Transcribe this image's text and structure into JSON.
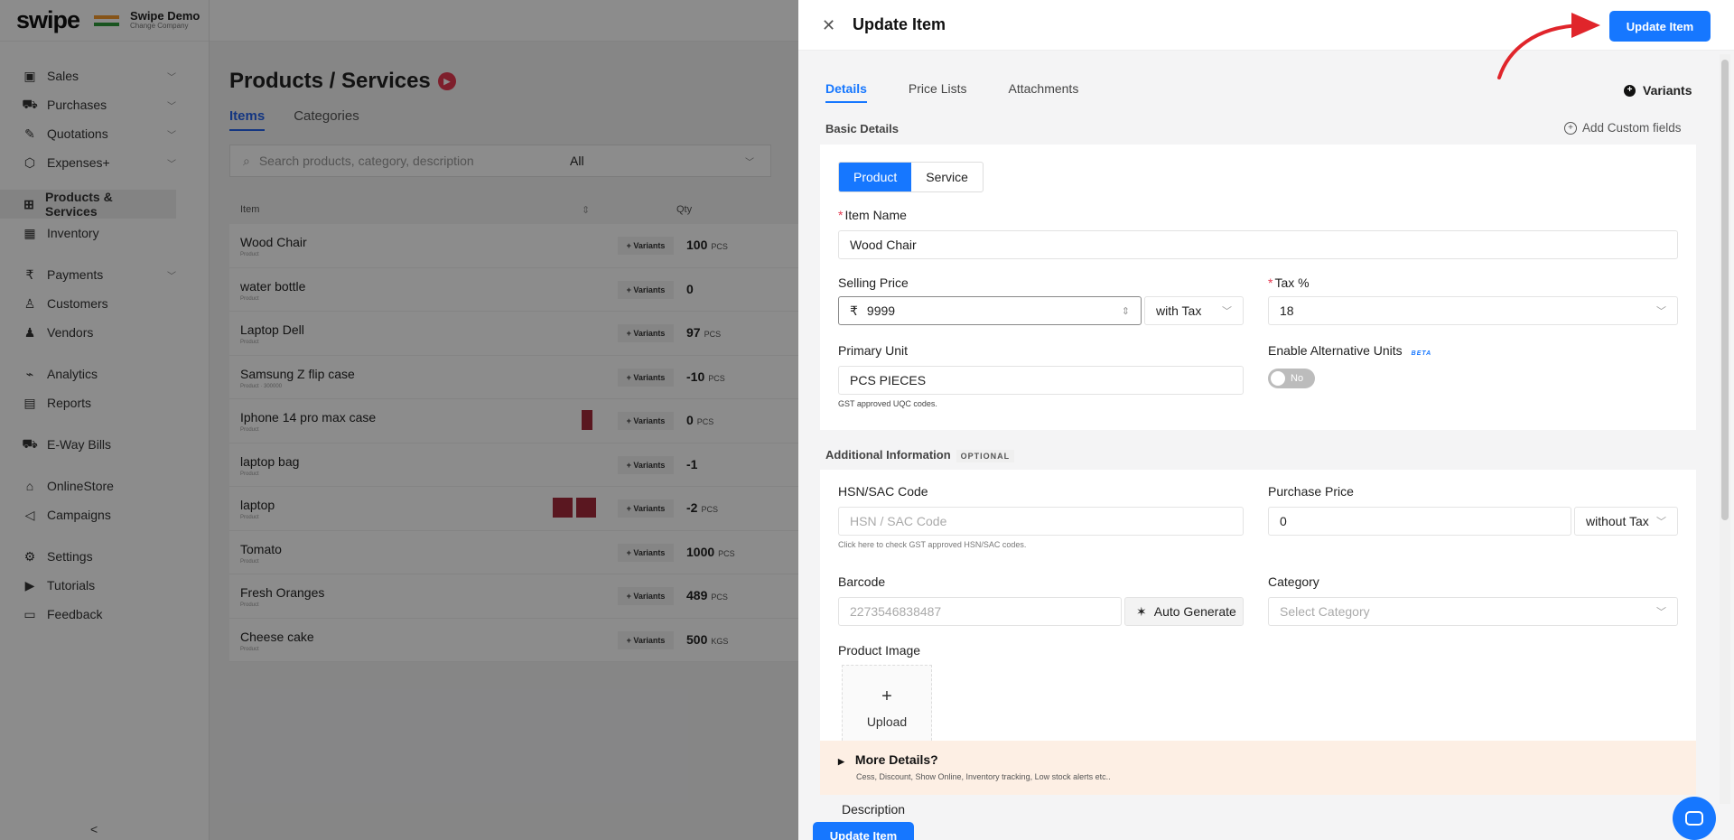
{
  "app": {
    "logo": "swipe",
    "company_name": "Swipe Demo",
    "company_sub": "Change Company"
  },
  "sidebar": {
    "items": [
      {
        "label": "Sales",
        "icon": "banknote-icon",
        "glyph": "▣",
        "chevron": true
      },
      {
        "label": "Purchases",
        "icon": "cart-icon",
        "glyph": "⛟",
        "chevron": true
      },
      {
        "label": "Quotations",
        "icon": "pen-icon",
        "glyph": "✎",
        "chevron": true
      },
      {
        "label": "Expenses+",
        "icon": "tag-icon",
        "glyph": "⬡",
        "chevron": true
      },
      {
        "label": "Products & Services",
        "icon": "box-icon",
        "glyph": "⊞",
        "active": true
      },
      {
        "label": "Inventory",
        "icon": "warehouse-icon",
        "glyph": "▦"
      },
      {
        "label": "Payments",
        "icon": "rupee-icon",
        "glyph": "₹",
        "chevron": true
      },
      {
        "label": "Customers",
        "icon": "user-icon",
        "glyph": "♙"
      },
      {
        "label": "Vendors",
        "icon": "users-icon",
        "glyph": "♟"
      },
      {
        "label": "Analytics",
        "icon": "chart-icon",
        "glyph": "⌁"
      },
      {
        "label": "Reports",
        "icon": "report-icon",
        "glyph": "▤"
      },
      {
        "label": "E-Way Bills",
        "icon": "truck-icon",
        "glyph": "⛟"
      },
      {
        "label": "OnlineStore",
        "icon": "store-icon",
        "glyph": "⌂"
      },
      {
        "label": "Campaigns",
        "icon": "megaphone-icon",
        "glyph": "◁"
      },
      {
        "label": "Settings",
        "icon": "gear-icon",
        "glyph": "⚙"
      },
      {
        "label": "Tutorials",
        "icon": "youtube-icon",
        "glyph": "▶"
      },
      {
        "label": "Feedback",
        "icon": "chat-icon",
        "glyph": "▭"
      }
    ],
    "collapse": "<"
  },
  "products": {
    "title": "Products / Services",
    "tabs": [
      "Items",
      "Categories"
    ],
    "search_placeholder": "Search products, category, description",
    "filter": "All",
    "columns": [
      "Item",
      "Qty"
    ],
    "variant_label": "+ Variants",
    "rows": [
      {
        "name": "Wood Chair",
        "sub": "Product",
        "qty": "100",
        "unit": "PCS"
      },
      {
        "name": "water bottle",
        "sub": "Product",
        "qty": "0",
        "unit": ""
      },
      {
        "name": "Laptop Dell",
        "sub": "Product",
        "qty": "97",
        "unit": "PCS"
      },
      {
        "name": "Samsung Z flip case",
        "sub": "Product · 300000",
        "qty": "-10",
        "unit": "PCS"
      },
      {
        "name": "Iphone 14 pro max case",
        "sub": "Product",
        "qty": "0",
        "unit": "PCS",
        "thumb": 1
      },
      {
        "name": "laptop bag",
        "sub": "Product",
        "qty": "-1",
        "unit": ""
      },
      {
        "name": "laptop",
        "sub": "Product",
        "qty": "-2",
        "unit": "PCS",
        "thumb": 2
      },
      {
        "name": "Tomato",
        "sub": "Product",
        "qty": "1000",
        "unit": "PCS"
      },
      {
        "name": "Fresh Oranges",
        "sub": "Product",
        "qty": "489",
        "unit": "PCS"
      },
      {
        "name": "Cheese cake",
        "sub": "Product",
        "qty": "500",
        "unit": "KGS"
      }
    ]
  },
  "drawer": {
    "title": "Update Item",
    "update_label": "Update Item",
    "tabs": [
      "Details",
      "Price Lists",
      "Attachments"
    ],
    "variants_label": "Variants",
    "basic_details": "Basic Details",
    "add_custom_fields": "Add Custom fields",
    "type_options": [
      "Product",
      "Service"
    ],
    "item_name_label": "Item Name",
    "item_name_value": "Wood Chair",
    "selling_price_label": "Selling Price",
    "currency": "₹",
    "selling_price_value": "9999",
    "tax_mode": "with Tax",
    "tax_label": "Tax %",
    "tax_value": "18",
    "primary_unit_label": "Primary Unit",
    "primary_unit_value": "PCS PIECES",
    "uqc_hint": "GST approved UQC codes.",
    "alt_units_label": "Enable Alternative Units",
    "beta": "BETA",
    "toggle_state": "No",
    "additional_info": "Additional Information",
    "optional": "OPTIONAL",
    "hsn_label": "HSN/SAC Code",
    "hsn_placeholder": "HSN / SAC Code",
    "hsn_hint": "Click here to check GST approved HSN/SAC codes.",
    "purchase_price_label": "Purchase Price",
    "purchase_price_value": "0",
    "purchase_tax_mode": "without Tax",
    "barcode_label": "Barcode",
    "barcode_placeholder": "2273546838487",
    "auto_generate": "Auto Generate",
    "category_label": "Category",
    "category_placeholder": "Select Category",
    "product_image_label": "Product Image",
    "upload_label": "Upload",
    "more_details_title": "More Details?",
    "more_details_sub": "Cess, Discount, Show Online, Inventory tracking, Low stock alerts etc..",
    "description_label": "Description",
    "bottom_update_label": "Update Item"
  },
  "colors": {
    "primary": "#1677ff",
    "annotation_arrow": "#e0252b"
  }
}
